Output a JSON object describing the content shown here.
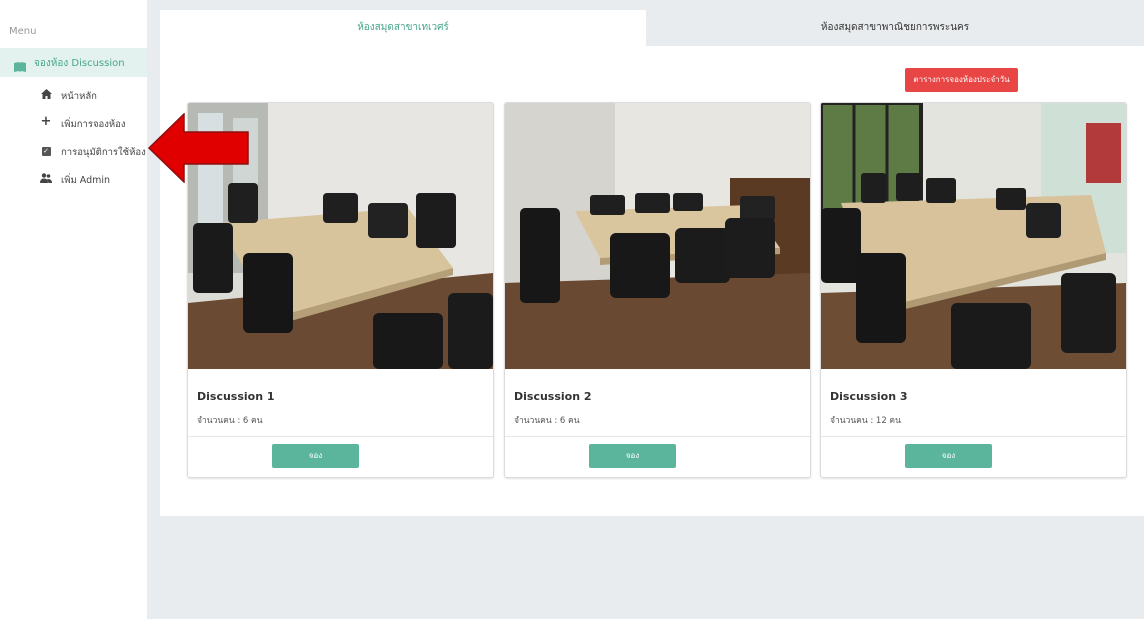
{
  "sidebar": {
    "menu_label": "Menu",
    "active_item": {
      "label": "จองห้อง Discussion",
      "icon": "book-icon"
    },
    "items": [
      {
        "label": "หน้าหลัก",
        "icon": "home-icon"
      },
      {
        "label": "เพิ่มการจองห้อง",
        "icon": "plus-icon"
      },
      {
        "label": "การอนุมัติการใช้ห้อง",
        "icon": "check-square-icon"
      },
      {
        "label": "เพิ่ม Admin",
        "icon": "users-icon"
      }
    ]
  },
  "tabs": [
    {
      "label": "ห้องสมุดสาขาเทเวศร์",
      "active": true
    },
    {
      "label": "ห้องสมุดสาขาพาณิชยการพระนคร",
      "active": false
    }
  ],
  "daily_schedule_button": "ตารางการจองห้องประจำวัน",
  "rooms": [
    {
      "title": "Discussion 1",
      "capacity": "จำนวนคน : 6 คน",
      "book_label": "จอง"
    },
    {
      "title": "Discussion 2",
      "capacity": "จำนวนคน : 6 คน",
      "book_label": "จอง"
    },
    {
      "title": "Discussion 3",
      "capacity": "จำนวนคน : 12 คน",
      "book_label": "จอง"
    }
  ],
  "colors": {
    "accent": "#5bb59c",
    "danger": "#e84545",
    "annotation_arrow": "#e00000"
  }
}
